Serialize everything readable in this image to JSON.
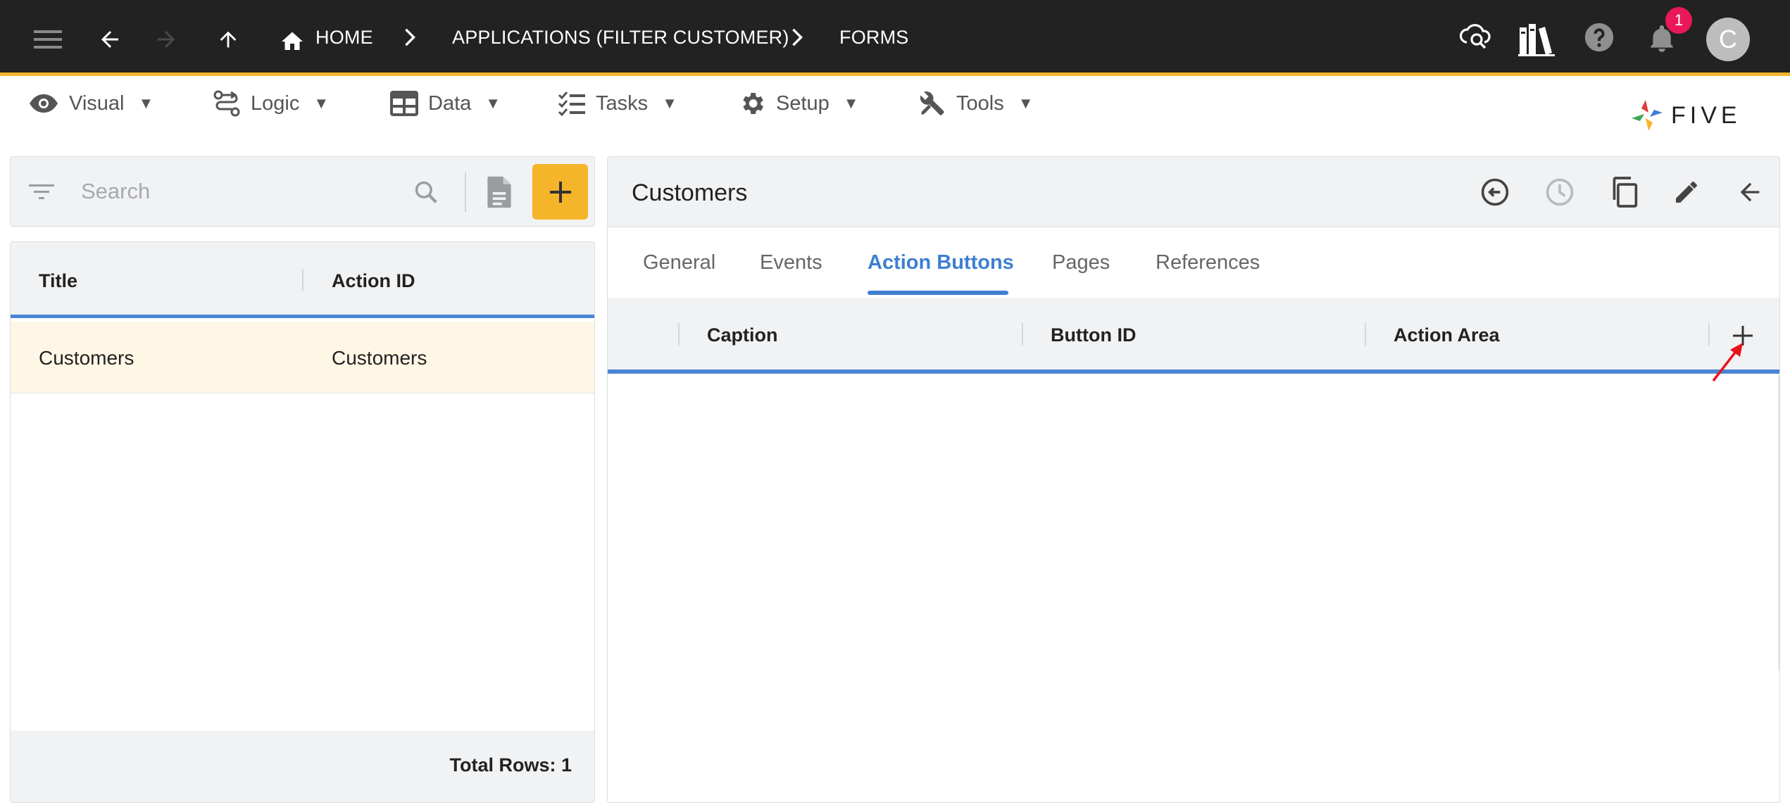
{
  "topbar": {
    "breadcrumbs": [
      {
        "label": "HOME",
        "icon": "home-icon"
      },
      {
        "label": "APPLICATIONS (FILTER CUSTOMER)"
      },
      {
        "label": "FORMS"
      }
    ],
    "notification_count": "1",
    "avatar_initial": "C",
    "accent_color": "#f5b52b"
  },
  "menu": {
    "items": [
      {
        "label": "Visual",
        "icon": "eye-icon"
      },
      {
        "label": "Logic",
        "icon": "logic-flow-icon"
      },
      {
        "label": "Data",
        "icon": "table-icon"
      },
      {
        "label": "Tasks",
        "icon": "checklist-icon"
      },
      {
        "label": "Setup",
        "icon": "gear-icon"
      },
      {
        "label": "Tools",
        "icon": "tools-icon"
      }
    ],
    "caret": "▼"
  },
  "logo": {
    "text": "FIVE"
  },
  "left": {
    "search_placeholder": "Search",
    "columns": [
      "Title",
      "Action ID"
    ],
    "rows": [
      {
        "title": "Customers",
        "action_id": "Customers"
      }
    ],
    "total_rows_label": "Total Rows: 1"
  },
  "right": {
    "title": "Customers",
    "tabs": [
      "General",
      "Events",
      "Action Buttons",
      "Pages",
      "References"
    ],
    "active_tab": "Action Buttons",
    "columns": [
      "Caption",
      "Button ID",
      "Action Area"
    ],
    "active_color": "#3e7fd2"
  }
}
